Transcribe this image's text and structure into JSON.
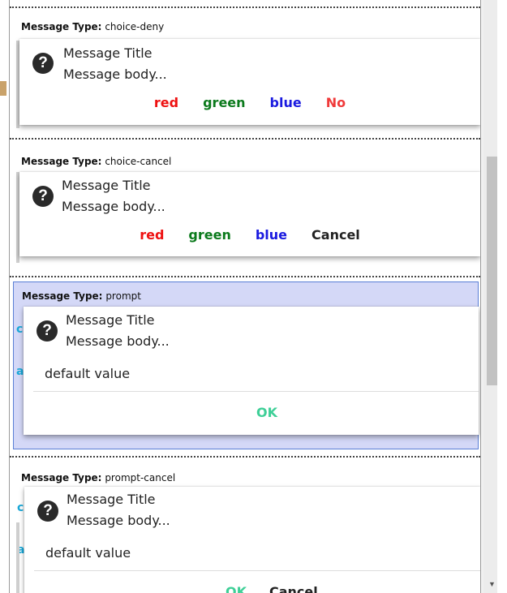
{
  "type_label_prefix": "Message Type:",
  "items": [
    {
      "type": "choice-deny",
      "title": "Message Title",
      "body": "Message body...",
      "choices": [
        {
          "label": "red",
          "color": "#ee1111"
        },
        {
          "label": "green",
          "color": "#0b7a1c"
        },
        {
          "label": "blue",
          "color": "#1a1ae0"
        },
        {
          "label": "No",
          "color": "#f03a3a"
        }
      ]
    },
    {
      "type": "choice-cancel",
      "title": "Message Title",
      "body": "Message body...",
      "choices": [
        {
          "label": "red",
          "color": "#ee1111"
        },
        {
          "label": "green",
          "color": "#0b7a1c"
        },
        {
          "label": "blue",
          "color": "#1a1ae0"
        },
        {
          "label": "Cancel",
          "color": "#222222"
        }
      ]
    },
    {
      "type": "prompt",
      "title": "Message Title",
      "body": "Message body...",
      "input_value": "default value",
      "ok_label": "OK",
      "selected": true
    },
    {
      "type": "prompt-cancel",
      "title": "Message Title",
      "body": "Message body...",
      "input_value": "default value",
      "ok_label": "OK",
      "cancel_label": "Cancel"
    }
  ],
  "colors": {
    "ok": "#3ecf97",
    "selection_bg": "#d4d8f7",
    "selection_border": "#5a7fd6",
    "accent": "#19a8d8"
  }
}
